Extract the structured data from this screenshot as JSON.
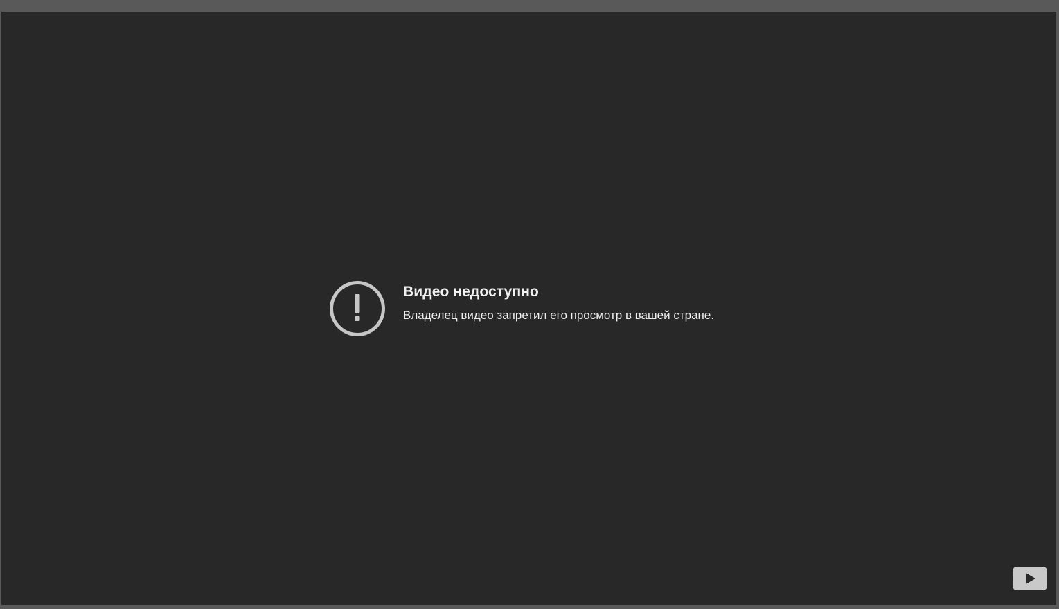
{
  "error": {
    "icon": "exclamation-circle-icon",
    "title": "Видео недоступно",
    "reason": "Владелец видео запретил его просмотр в вашей стране."
  },
  "branding": {
    "logo_icon": "youtube-logo-icon"
  },
  "colors": {
    "frame_background": "#595959",
    "player_background": "#282828",
    "icon_color": "#c6c6c6",
    "text_color": "#f1f1f1"
  }
}
